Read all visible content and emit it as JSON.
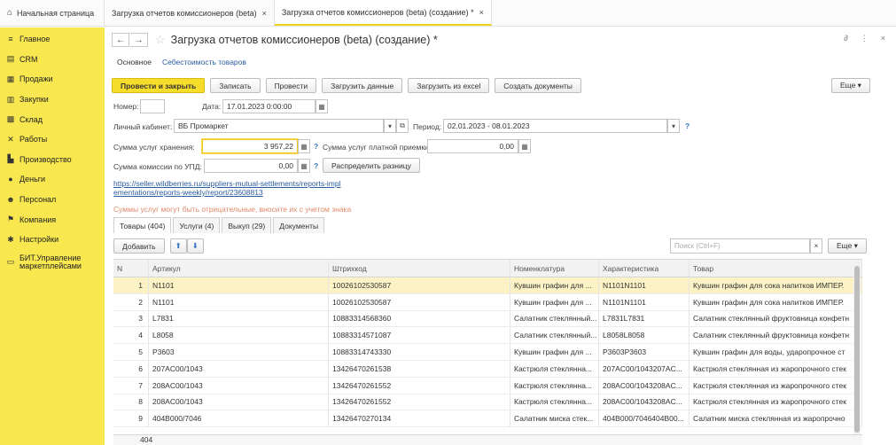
{
  "top_tabs": {
    "home": "Начальная страница",
    "tab1": "Загрузка отчетов комиссионеров (beta)",
    "tab2": "Загрузка отчетов комиссионеров (beta) (создание) *",
    "close": "×"
  },
  "sidebar": {
    "items": [
      {
        "label": "Главное",
        "icon": "menu-icon"
      },
      {
        "label": "CRM",
        "icon": "crm-icon"
      },
      {
        "label": "Продажи",
        "icon": "sales-icon"
      },
      {
        "label": "Закупки",
        "icon": "purchases-icon"
      },
      {
        "label": "Склад",
        "icon": "warehouse-icon"
      },
      {
        "label": "Работы",
        "icon": "tools-icon"
      },
      {
        "label": "Производство",
        "icon": "factory-icon"
      },
      {
        "label": "Деньги",
        "icon": "money-icon"
      },
      {
        "label": "Персонал",
        "icon": "staff-icon"
      },
      {
        "label": "Компания",
        "icon": "flag-icon"
      },
      {
        "label": "Настройки",
        "icon": "gear-icon"
      },
      {
        "label": "БИТ.Управление маркетплейсами",
        "icon": "chat-icon"
      }
    ]
  },
  "form": {
    "title": "Загрузка отчетов комиссионеров (beta) (создание) *",
    "subtab_main": "Основное",
    "subtab_cost": "Себестоимость товаров",
    "buttons": {
      "post_close": "Провести и закрыть",
      "save": "Записать",
      "post": "Провести",
      "load": "Загрузить данные",
      "load_excel": "Загрузить из excel",
      "create_docs": "Создать документы",
      "more": "Еще ▾"
    },
    "number_label": "Номер:",
    "date_label": "Дата:",
    "date_value": "17.01.2023  0:00:00",
    "cabinet_label": "Личный кабинет:",
    "cabinet_value": "ВБ Промаркет",
    "period_label": "Период:",
    "period_value": "02.01.2023 - 08.01.2023",
    "storage_label": "Сумма услуг хранения:",
    "storage_value": "3 957,22",
    "paid_accept_label": "Сумма услуг платной приемки:",
    "paid_accept_value": "0,00",
    "commission_label": "Сумма комиссии по УПД:",
    "commission_value": "0,00",
    "distribute_button": "Распределить разницу",
    "url_line1": "https://seller.wildberries.ru/suppliers-mutual-settlements/reports-impl",
    "url_line2": "ementations/reports-weekly/report/23608813",
    "note": "Суммы услуг могут быть отрицательные, вносите их  с учетом знака"
  },
  "page_tabs": [
    "Товары (404)",
    "Услуги (4)",
    "Выкуп (29)",
    "Документы"
  ],
  "table": {
    "add_button": "Добавить",
    "search_placeholder": "Поиск (Ctrl+F)",
    "more": "Еще ▾",
    "columns": [
      "N",
      "Артикул",
      "Штрихкод",
      "Номенклатура",
      "Характеристика",
      "Товар"
    ],
    "rows": [
      [
        "1",
        "N1101",
        "10026102530587",
        "Кувшин графин для ...",
        "N1101N1101",
        "Кувшин графин для сока напитков  ИМПЕР."
      ],
      [
        "2",
        "N1101",
        "10026102530587",
        "Кувшин графин для ...",
        "N1101N1101",
        "Кувшин графин для сока напитков  ИМПЕР."
      ],
      [
        "3",
        "L7831",
        "10883314568360",
        "Салатник стеклянный...",
        "L7831L7831",
        "Салатник стеклянный фруктовница конфетн"
      ],
      [
        "4",
        "L8058",
        "10883314571087",
        "Салатник стеклянный...",
        "L8058L8058",
        "Салатник стеклянный фруктовница конфетн"
      ],
      [
        "5",
        "P3603",
        "10883314743330",
        "Кувшин графин для ...",
        "P3603P3603",
        "Кувшин графин для воды, ударопрочное ст"
      ],
      [
        "6",
        "207AC00/1043",
        "13426470261538",
        "Кастрюля стеклянна...",
        "207AC00/1043207AC...",
        "Кастрюля стеклянная из жаропрочного стек"
      ],
      [
        "7",
        "208AC00/1043",
        "13426470261552",
        "Кастрюля стеклянна...",
        "208AC00/1043208AC...",
        "Кастрюля стеклянная из жаропрочного стек"
      ],
      [
        "8",
        "208AC00/1043",
        "13426470261552",
        "Кастрюля стеклянна...",
        "208AC00/1043208AC...",
        "Кастрюля стеклянная из жаропрочного стек"
      ],
      [
        "9",
        "404B000/7046",
        "13426470270134",
        "Салатник миска стек...",
        "404B000/7046404B00...",
        "Салатник миска стеклянная из жаропрочно"
      ]
    ],
    "total": "404"
  }
}
